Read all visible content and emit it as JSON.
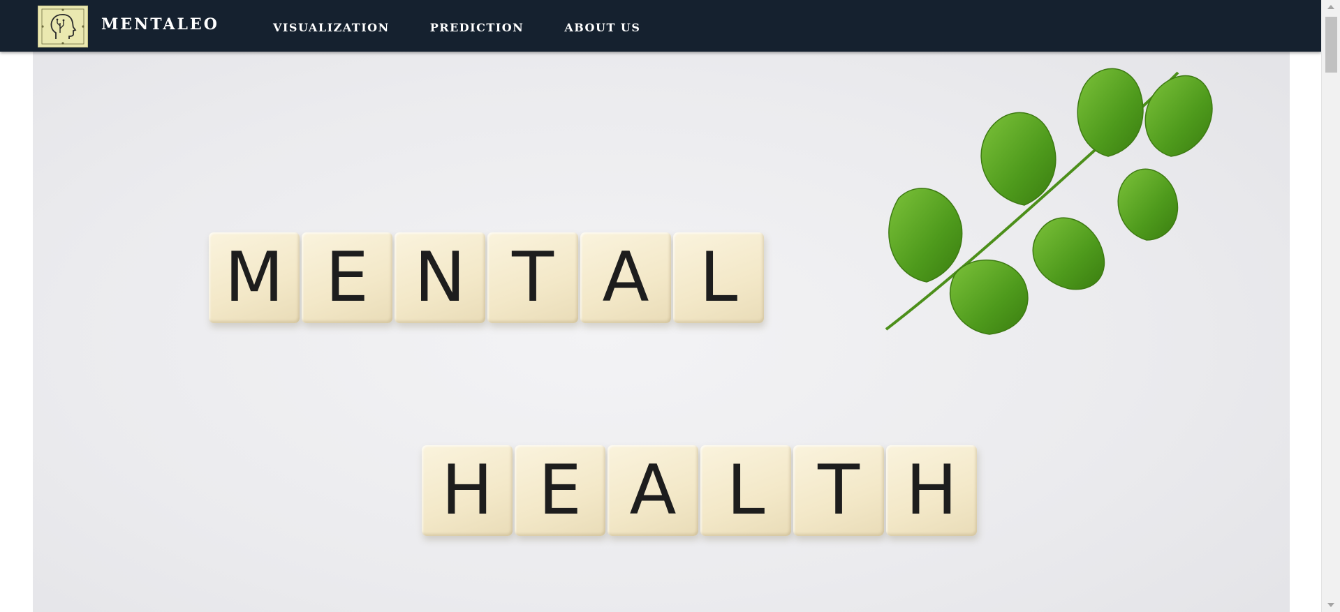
{
  "navbar": {
    "brand": "MENTALEO",
    "links": [
      "VISUALIZATION",
      "PREDICTION",
      "ABOUT US"
    ],
    "background_color": "#15212f",
    "logo_icon": "head-circuit-icon"
  },
  "hero": {
    "line1_letters": [
      "M",
      "E",
      "N",
      "T",
      "A",
      "L"
    ],
    "line2_letters": [
      "H",
      "E",
      "A",
      "L",
      "T",
      "H"
    ],
    "decoration": "green-leaf-sprig"
  }
}
